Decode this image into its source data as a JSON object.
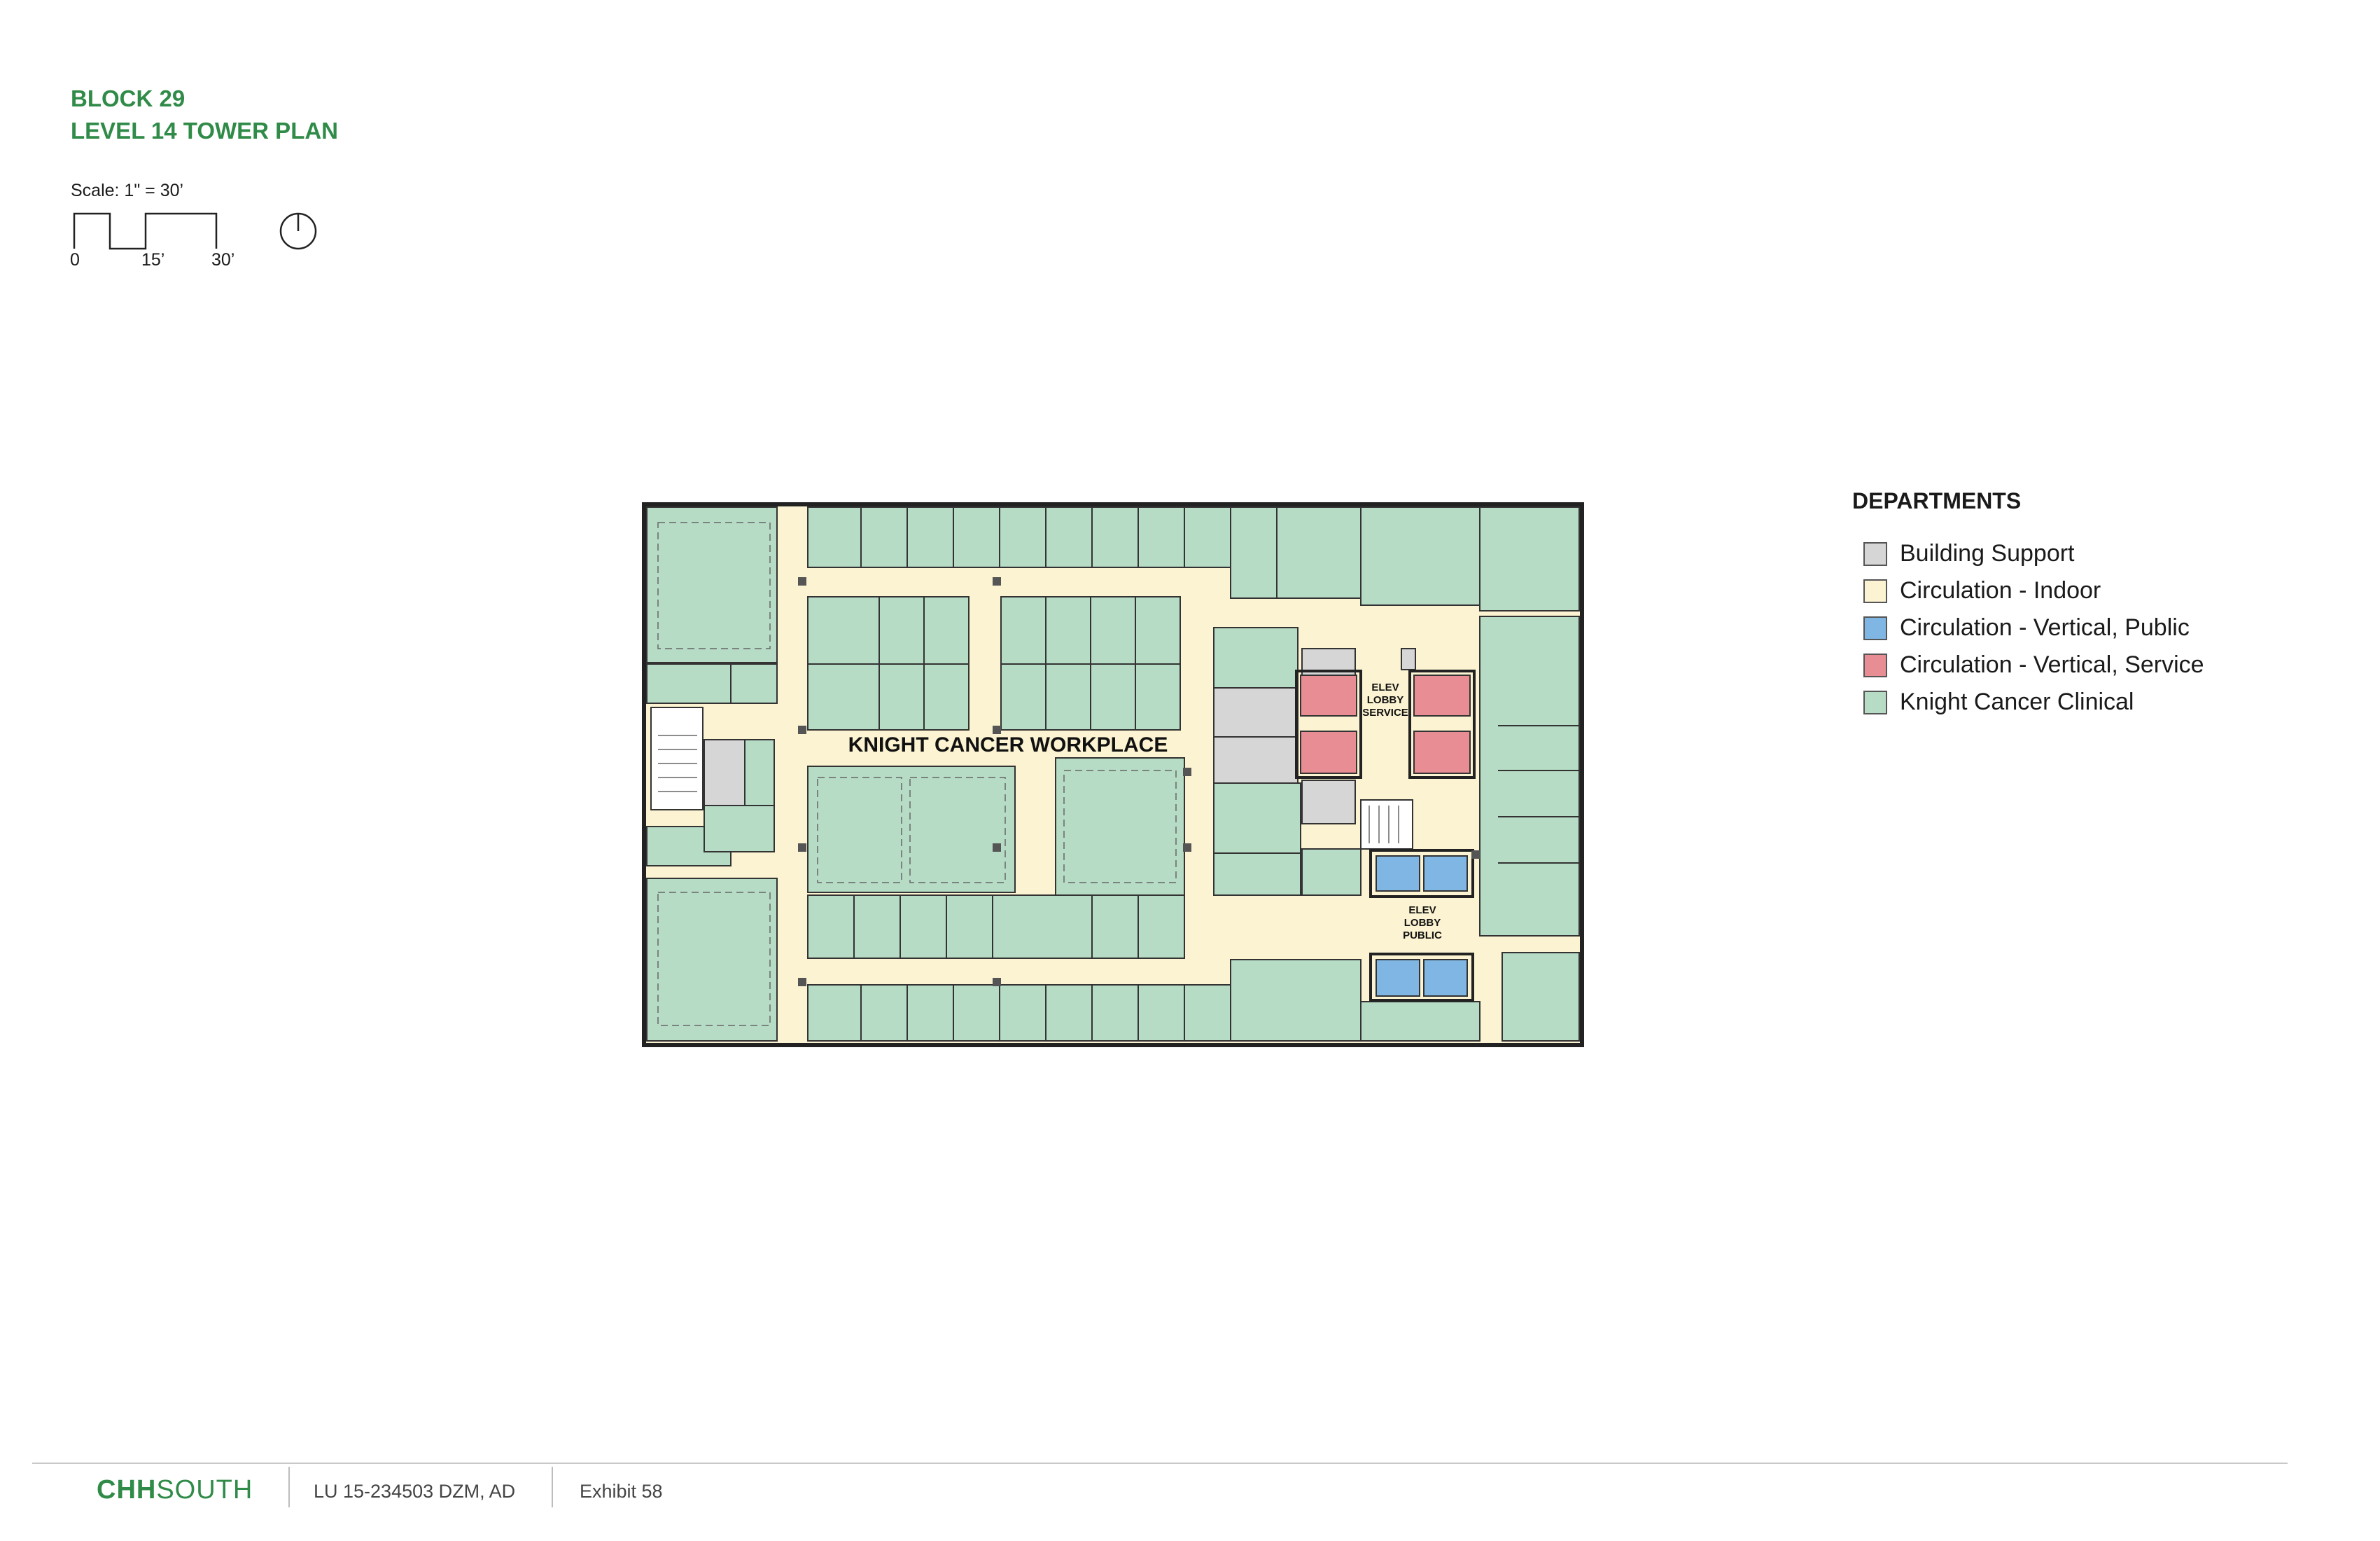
{
  "header": {
    "title_line1": "BLOCK 29",
    "title_line2": "LEVEL 14 TOWER PLAN"
  },
  "scale": {
    "label": "Scale: 1\" = 30’",
    "tick_0": "0",
    "tick_15": "15’",
    "tick_30": "30’"
  },
  "north_arrow": {
    "icon": "north-arrow-icon"
  },
  "plan": {
    "main_label": "KNIGHT CANCER WORKPLACE",
    "service_lobby": [
      "ELEV",
      "LOBBY",
      "SERVICE"
    ],
    "public_lobby": [
      "ELEV",
      "LOBBY",
      "PUBLIC"
    ]
  },
  "legend": {
    "title": "DEPARTMENTS",
    "items": [
      {
        "label": "Building Support",
        "color": "#d6d6d6"
      },
      {
        "label": "Circulation - Indoor",
        "color": "#fbf3d1"
      },
      {
        "label": "Circulation - Vertical, Public",
        "color": "#7fb6e4"
      },
      {
        "label": "Circulation - Vertical, Service",
        "color": "#e88d93"
      },
      {
        "label": "Knight Cancer Clinical",
        "color": "#b7dcc6"
      }
    ]
  },
  "footer": {
    "brand_bold": "CHH",
    "brand_light": "SOUTH",
    "case_number": "LU 15-234503 DZM, AD",
    "exhibit": "Exhibit 58"
  }
}
